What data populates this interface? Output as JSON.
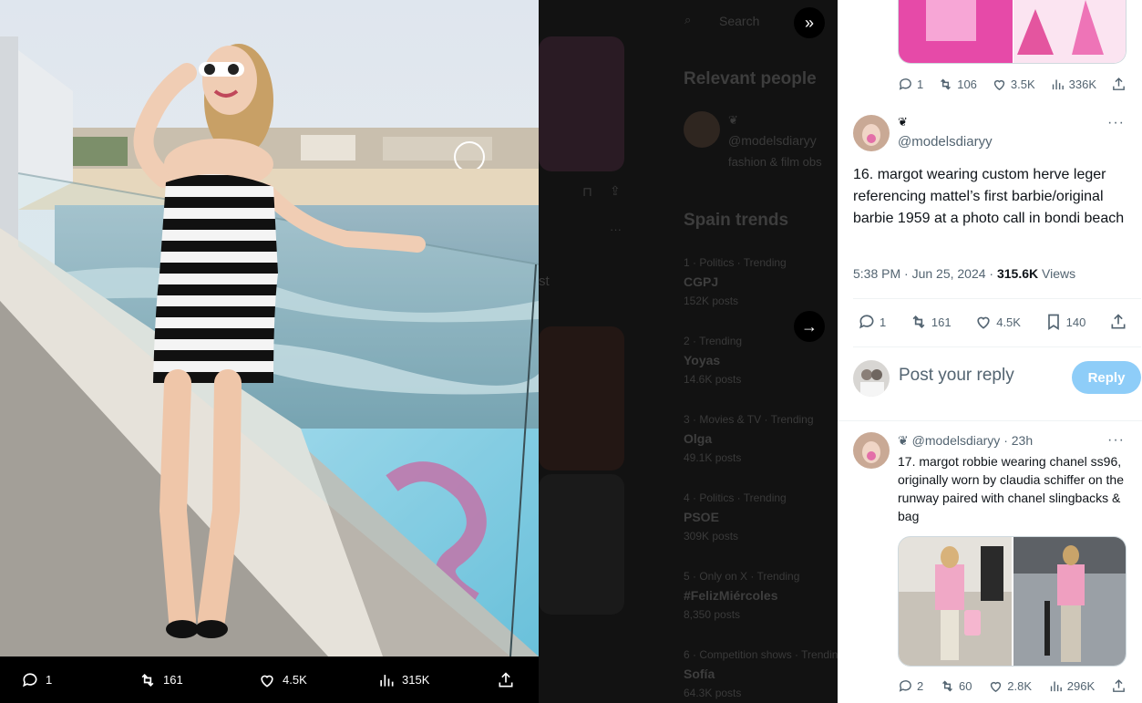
{
  "media_viewer": {
    "background_ghost": {
      "search_placeholder": "Search",
      "relevant_people_title": "Relevant people",
      "person_handle": "@modelsdiaryy",
      "person_bio": "fashion & film obs",
      "trends_title": "Spain trends",
      "trends": [
        {
          "context": "1 · Politics · Trending",
          "name": "CGPJ",
          "posts": "152K posts"
        },
        {
          "context": "2 · Trending",
          "name": "Yoyas",
          "posts": "14.6K posts"
        },
        {
          "context": "3 · Movies & TV · Trending",
          "name": "Olga",
          "posts": "49.1K posts"
        },
        {
          "context": "4 · Politics · Trending",
          "name": "PSOE",
          "posts": "309K posts"
        },
        {
          "context": "5 · Only on X · Trending",
          "name": "#FelizMiércoles",
          "posts": "8,350 posts"
        },
        {
          "context": "6 · Competition shows · Trending",
          "name": "Sofía",
          "posts": "64.3K posts"
        }
      ],
      "stray_text": "st"
    },
    "actions": {
      "replies": "1",
      "reposts": "161",
      "likes": "4.5K",
      "views": "315K"
    }
  },
  "thread": {
    "prev_tweet_stats": {
      "replies": "1",
      "reposts": "106",
      "likes": "3.5K",
      "views": "336K"
    },
    "main_tweet": {
      "name_emoji": "❦",
      "handle": "@modelsdiaryy",
      "text": "16. margot wearing custom herve leger referencing mattel’s first barbie/original barbie 1959 at a photo call in bondi beach",
      "time": "5:38 PM · Jun 25, 2024 · ",
      "views_count": "315.6K",
      "views_label": " Views",
      "stats": {
        "replies": "1",
        "reposts": "161",
        "likes": "4.5K",
        "bookmarks": "140"
      }
    },
    "reply_composer": {
      "placeholder": "Post your reply",
      "button": "Reply"
    },
    "next_tweet": {
      "header": "❦ @modelsdiaryy · 23h",
      "text": "17. margot robbie wearing chanel ss96, originally worn by claudia schiffer on the runway paired with chanel slingbacks & bag",
      "stats": {
        "replies": "2",
        "reposts": "60",
        "likes": "2.8K",
        "views": "296K"
      }
    }
  },
  "colors": {
    "accent": "#1d9bf0",
    "reply_button_disabled": "#8ecdf8",
    "muted_text": "#536471"
  }
}
